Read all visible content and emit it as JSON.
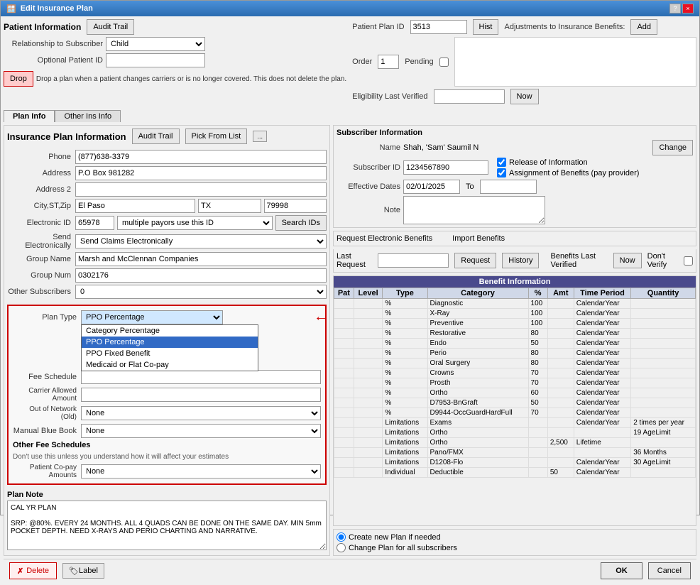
{
  "window": {
    "title": "Edit Insurance Plan",
    "help_btn": "?",
    "close_btn": "×"
  },
  "patient_info": {
    "section_label": "Patient Information",
    "audit_trail_btn": "Audit Trail",
    "relationship_label": "Relationship to Subscriber",
    "relationship_value": "Child",
    "optional_patient_id_label": "Optional Patient ID",
    "patient_plan_id_label": "Patient Plan ID",
    "patient_plan_id_value": "3513",
    "hist_btn": "Hist",
    "adjustments_label": "Adjustments to Insurance Benefits:",
    "add_btn": "Add",
    "order_label": "Order",
    "order_value": "1",
    "pending_label": "Pending",
    "eligibility_label": "Eligibility Last Verified",
    "now_btn": "Now",
    "drop_btn": "Drop",
    "drop_message": "Drop a plan when a patient changes carriers or is no longer covered.  This does not delete the plan."
  },
  "tabs": {
    "plan_info": "Plan Info",
    "other_ins_info": "Other Ins Info"
  },
  "insurance_plan": {
    "title": "Insurance Plan Information",
    "audit_trail_btn": "Audit Trail",
    "pick_from_list_btn": "Pick From List",
    "expand_btn": "...",
    "phone_label": "Phone",
    "phone_value": "(877)638-3379",
    "address_label": "Address",
    "address_value": "P.O Box 981282",
    "address2_label": "Address 2",
    "address2_value": "",
    "city_label": "City,ST,Zip",
    "city_value": "El Paso",
    "state_value": "TX",
    "zip_value": "79998",
    "electronic_id_label": "Electronic ID",
    "electronic_id_value": "65978",
    "multiple_payors_label": "multiple payors use this ID",
    "search_ids_btn": "Search IDs",
    "send_electronically_label": "Send Electronically",
    "send_electronically_value": "Send Claims Electronically",
    "group_name_label": "Group Name",
    "group_name_value": "Marsh and McClennan Companies",
    "group_num_label": "Group Num",
    "group_num_value": "0302176",
    "other_subscribers_label": "Other Subscribers",
    "other_subscribers_value": "0"
  },
  "plan_type_section": {
    "plan_type_label": "Plan Type",
    "plan_type_value": "PPO Percentage",
    "fee_schedule_label": "Fee Schedule",
    "fee_schedule_value": "",
    "carrier_allowed_label": "Carrier Allowed Amount",
    "carrier_allowed_value": "",
    "out_of_network_label": "Out of Network (Old)",
    "out_of_network_value": "None",
    "manual_blue_book_label": "Manual Blue Book",
    "manual_blue_book_value": "None",
    "other_fee_label": "Other Fee Schedules",
    "other_fee_message": "Don't use this unless you understand how it will affect your estimates",
    "patient_copay_label": "Patient Co-pay Amounts",
    "patient_copay_value": "None",
    "dropdown_options": [
      {
        "value": "Category Percentage",
        "label": "Category Percentage"
      },
      {
        "value": "PPO Percentage",
        "label": "PPO Percentage",
        "selected": true
      },
      {
        "value": "PPO Fixed Benefit",
        "label": "PPO Fixed Benefit"
      },
      {
        "value": "Medicaid or Flat Co-pay",
        "label": "Medicaid or Flat Co-pay"
      }
    ]
  },
  "subscriber": {
    "section_label": "Subscriber Information",
    "change_btn": "Change",
    "name_label": "Name",
    "name_value": "Shah, 'Sam' Saumil N",
    "subscriber_id_label": "Subscriber ID",
    "subscriber_id_value": "1234567890",
    "release_info_label": "Release of Information",
    "assignment_benefits_label": "Assignment of Benefits (pay provider)",
    "effective_dates_label": "Effective Dates",
    "effective_date_value": "02/01/2025",
    "to_label": "To",
    "note_label": "Note"
  },
  "electronic_benefits": {
    "request_label": "Request Electronic Benefits",
    "import_label": "Import Benefits",
    "last_request_label": "Last Request",
    "request_btn": "Request",
    "history_btn": "History",
    "benefits_last_verified_label": "Benefits Last Verified",
    "now_btn": "Now",
    "dont_verify_label": "Don't Verify"
  },
  "benefit_table": {
    "title": "Benefit Information",
    "headers": [
      "Pat",
      "Level",
      "Type",
      "Category",
      "%",
      "Amt",
      "Time Period",
      "Quantity"
    ],
    "rows": [
      {
        "pat": "",
        "level": "",
        "type": "%",
        "category": "Diagnostic",
        "pct": "100",
        "amt": "",
        "time_period": "CalendarYear",
        "quantity": ""
      },
      {
        "pat": "",
        "level": "",
        "type": "%",
        "category": "X-Ray",
        "pct": "100",
        "amt": "",
        "time_period": "CalendarYear",
        "quantity": ""
      },
      {
        "pat": "",
        "level": "",
        "type": "%",
        "category": "Preventive",
        "pct": "100",
        "amt": "",
        "time_period": "CalendarYear",
        "quantity": ""
      },
      {
        "pat": "",
        "level": "",
        "type": "%",
        "category": "Restorative",
        "pct": "80",
        "amt": "",
        "time_period": "CalendarYear",
        "quantity": ""
      },
      {
        "pat": "",
        "level": "",
        "type": "%",
        "category": "Endo",
        "pct": "50",
        "amt": "",
        "time_period": "CalendarYear",
        "quantity": ""
      },
      {
        "pat": "",
        "level": "",
        "type": "%",
        "category": "Perio",
        "pct": "80",
        "amt": "",
        "time_period": "CalendarYear",
        "quantity": ""
      },
      {
        "pat": "",
        "level": "",
        "type": "%",
        "category": "Oral Surgery",
        "pct": "80",
        "amt": "",
        "time_period": "CalendarYear",
        "quantity": ""
      },
      {
        "pat": "",
        "level": "",
        "type": "%",
        "category": "Crowns",
        "pct": "70",
        "amt": "",
        "time_period": "CalendarYear",
        "quantity": ""
      },
      {
        "pat": "",
        "level": "",
        "type": "%",
        "category": "Prosth",
        "pct": "70",
        "amt": "",
        "time_period": "CalendarYear",
        "quantity": ""
      },
      {
        "pat": "",
        "level": "",
        "type": "%",
        "category": "Ortho",
        "pct": "60",
        "amt": "",
        "time_period": "CalendarYear",
        "quantity": ""
      },
      {
        "pat": "",
        "level": "",
        "type": "%",
        "category": "D7953-BnGraft",
        "pct": "50",
        "amt": "",
        "time_period": "CalendarYear",
        "quantity": ""
      },
      {
        "pat": "",
        "level": "",
        "type": "%",
        "category": "D9944-OccGuardHardFull",
        "pct": "70",
        "amt": "",
        "time_period": "CalendarYear",
        "quantity": ""
      },
      {
        "pat": "",
        "level": "",
        "type": "Limitations",
        "category": "Exams",
        "pct": "",
        "amt": "",
        "time_period": "CalendarYear",
        "quantity": "2 times per year"
      },
      {
        "pat": "",
        "level": "",
        "type": "Limitations",
        "category": "Ortho",
        "pct": "",
        "amt": "",
        "time_period": "",
        "quantity": "19 AgeLimit"
      },
      {
        "pat": "",
        "level": "",
        "type": "Limitations",
        "category": "Ortho",
        "pct": "",
        "amt": "2,500",
        "time_period": "Lifetime",
        "quantity": ""
      },
      {
        "pat": "",
        "level": "",
        "type": "Limitations",
        "category": "Pano/FMX",
        "pct": "",
        "amt": "",
        "time_period": "",
        "quantity": "36 Months"
      },
      {
        "pat": "",
        "level": "",
        "type": "Limitations",
        "category": "D1208-Flo",
        "pct": "",
        "amt": "",
        "time_period": "CalendarYear",
        "quantity": "30 AgeLimit"
      },
      {
        "pat": "",
        "level": "",
        "type": "Individual",
        "category": "Deductible",
        "pct": "",
        "amt": "50",
        "time_period": "CalendarYear",
        "quantity": ""
      }
    ]
  },
  "plan_note": {
    "label": "Plan Note",
    "text": "CAL YR PLAN\n\nSRP: @80%. EVERY 24 MONTHS. ALL 4 QUADS CAN BE DONE ON THE SAME DAY. MIN 5mm POCKET DEPTH. NEED X-RAYS AND PERIO CHARTING AND NARRATIVE."
  },
  "bottom": {
    "radio1": "Create new Plan if needed",
    "radio2": "Change Plan for all subscribers",
    "delete_btn": "Delete",
    "label_btn": "Label",
    "ok_btn": "OK",
    "cancel_btn": "Cancel"
  }
}
